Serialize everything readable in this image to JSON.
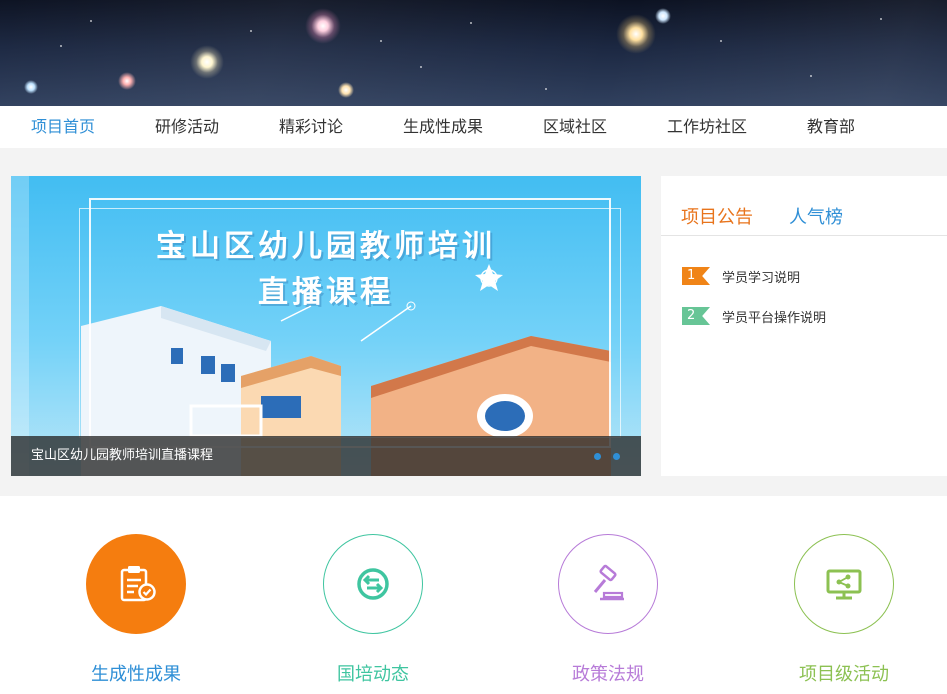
{
  "nav": {
    "items": [
      {
        "label": "项目首页",
        "active": true
      },
      {
        "label": "研修活动",
        "active": false
      },
      {
        "label": "精彩讨论",
        "active": false
      },
      {
        "label": "生成性成果",
        "active": false
      },
      {
        "label": "区域社区",
        "active": false
      },
      {
        "label": "工作坊社区",
        "active": false
      },
      {
        "label": "教育部",
        "active": false
      }
    ]
  },
  "slider": {
    "title_line1": "宝山区幼儿园教师培训",
    "title_line2": "直播课程",
    "caption": "宝山区幼儿园教师培训直播课程",
    "dot_color": "#2f8fd6"
  },
  "notice_panel": {
    "tabs": [
      {
        "label": "项目公告",
        "active": true
      },
      {
        "label": "人气榜",
        "active": false
      }
    ],
    "items": [
      {
        "num": "1",
        "text": "学员学习说明",
        "color": "#f08417"
      },
      {
        "num": "2",
        "text": "学员平台操作说明",
        "color": "#67c596"
      }
    ]
  },
  "features": [
    {
      "label": "生成性成果",
      "icon": "clipboard-check-icon",
      "color": "#f57d0f",
      "label_color": "#2f8fd6"
    },
    {
      "label": "国培动态",
      "icon": "exchange-arrows-icon",
      "color": "#3fc5a0",
      "label_color": "#3fc5a0"
    },
    {
      "label": "政策法规",
      "icon": "gavel-icon",
      "color": "#b77bd8",
      "label_color": "#b77bd8"
    },
    {
      "label": "项目级活动",
      "icon": "monitor-share-icon",
      "color": "#8cc152",
      "label_color": "#8cc152"
    }
  ],
  "colors": {
    "accent_blue": "#2f8fd6",
    "accent_orange": "#e8741c"
  }
}
